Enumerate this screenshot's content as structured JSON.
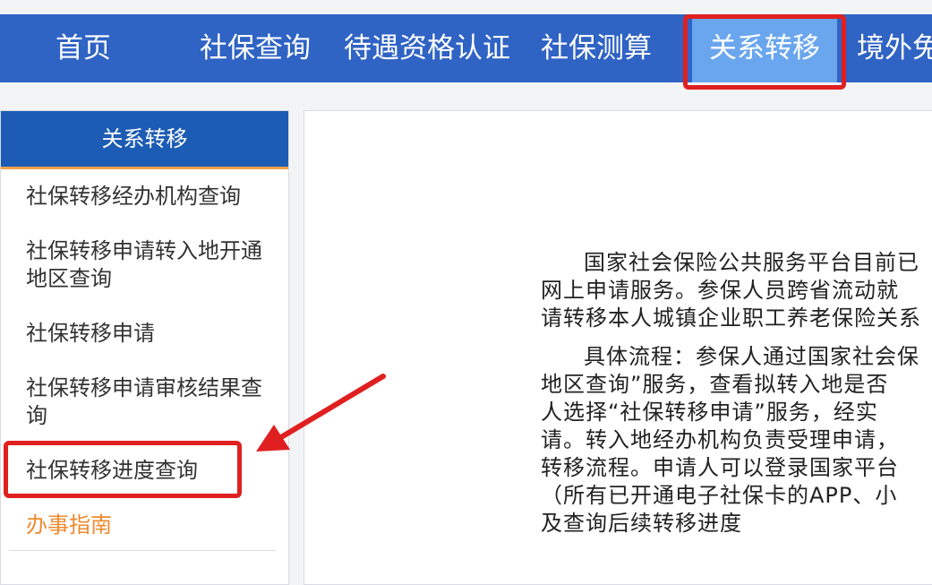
{
  "nav": {
    "items": [
      {
        "label": "首页"
      },
      {
        "label": "社保查询"
      },
      {
        "label": "待遇资格认证"
      },
      {
        "label": "社保测算"
      },
      {
        "label": "关系转移"
      },
      {
        "label": "境外免"
      }
    ],
    "active_index": 4
  },
  "sidebar": {
    "title": "关系转移",
    "items": [
      {
        "label": "社保转移经办机构查询"
      },
      {
        "label": "社保转移申请转入地开通地区查询"
      },
      {
        "label": "社保转移申请"
      },
      {
        "label": "社保转移申请审核结果查询"
      },
      {
        "label": "社保转移进度查询"
      },
      {
        "label": "办事指南"
      }
    ]
  },
  "content": {
    "paragraph1": [
      "国家社会保险公共服务平台目前已",
      "网上申请服务。参保人员跨省流动就",
      "请转移本人城镇企业职工养老保险关系"
    ],
    "paragraph2": [
      "具体流程：参保人通过国家社会保",
      "地区查询”服务，查看拟转入地是否",
      "人选择“社保转移申请”服务，经实",
      "请。转入地经办机构负责受理申请，",
      "转移流程。申请人可以登录国家平台",
      "（所有已开通电子社保卡的APP、小",
      "及查询后续转移进度"
    ]
  },
  "colors": {
    "nav_bg": "#2f63c4",
    "nav_active_bg": "#6aa6ee",
    "sidebar_header_bg": "#1d5cb4",
    "accent_orange": "#ef8a2c",
    "annotation_red": "#e02020"
  }
}
